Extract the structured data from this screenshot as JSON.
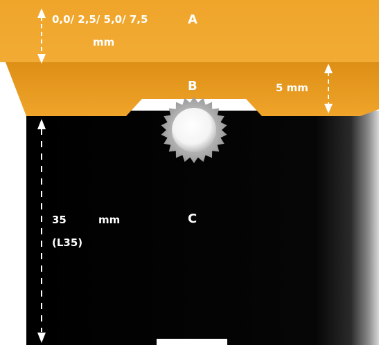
{
  "labels": {
    "a": "A",
    "b": "B",
    "c": "C",
    "a_dimension_line1": "0,0/ 2,5/ 5,0/ 7,5",
    "a_dimension_line2": "mm",
    "b_dimension": "5 mm",
    "c_dimension_value": "35",
    "c_dimension_unit": "mm",
    "c_dimension_code": "(L35)"
  },
  "colors": {
    "orange": "#efa52a",
    "orange_dark": "#d88a12",
    "body_black": "#050505",
    "text": "#ffffff"
  }
}
